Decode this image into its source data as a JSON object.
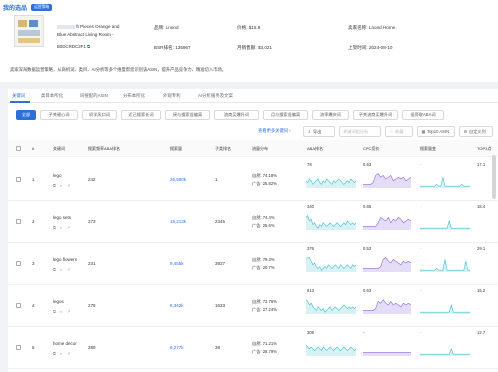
{
  "header": {
    "title": "我的选品",
    "badge": "运营策略"
  },
  "product": {
    "title_line1": "ft Pieces Orange and",
    "title_line2": "Blue Abstract Living Room -",
    "asin": "B0DCRDC2F1",
    "brand_label": "品牌:",
    "brand_value": "Lnond",
    "price_label": "价格:",
    "price_value": "$15.9",
    "seller_label": "卖家名称:",
    "seller_value": "Lnond Home",
    "bsr_label": "BSR排名:",
    "bsr_value": "135967",
    "monthly_label": "月销售额:",
    "monthly_value": "$3,021",
    "launch_label": "上架时间:",
    "launch_value": "2024-08-10"
  },
  "description": "卖家深海数据运营策略，从商机词、类目、AI分析等多个维度帮您识别该ASIN，提升产品竞争力、精准切入市场。",
  "tabs": [
    "关键词",
    "类目本所化",
    "同搜配的ASIN",
    "分布本所化",
    "外观专利",
    "AI分析服务及文案"
  ],
  "filters": [
    "全部",
    "子关键心词",
    "初学风口词",
    "近己搜索长词",
    "接与搜索竖偏离",
    "流商买爆升词",
    "月与搜索竖偏离",
    "流率爆庆词",
    "子关流商买爆升词",
    "低旁取ABA词"
  ],
  "actions": {
    "suggest": "查看更多关键词",
    "export": "导出",
    "analyze": "关键词组分析",
    "favorite": "收藏",
    "top10": "Top10 ASIN",
    "custom": "自定义列"
  },
  "columns": {
    "index": "#",
    "keyword": "关键词",
    "aba_rank": "搜索频率ABA排名",
    "search_volume": "搜索量",
    "competition": "子类排名",
    "traffic": "流量分布",
    "aba_trend": "ABA排名",
    "cpc_trend": "CPC竞价",
    "search_trend": "搜索量变",
    "top3": "TOP3点"
  },
  "rows": [
    {
      "index": "1",
      "keyword": "lego",
      "aba_rank": "242",
      "volume": "26,580k",
      "competition": "1",
      "natural": "自然: 74.18%",
      "ad": "广告: 25.82%",
      "aba_val": "78",
      "cpc_val": "0.63",
      "top3": "17.1"
    },
    {
      "index": "2",
      "keyword": "lego sets",
      "aba_rank": "273",
      "volume": "15,213k",
      "competition": "2345",
      "natural": "自然: 74.4%",
      "ad": "广告: 25.6%",
      "aba_val": "340",
      "cpc_val": "0.65",
      "top3": "18.4"
    },
    {
      "index": "3",
      "keyword": "lego flowers",
      "aba_rank": "231",
      "volume": "9,455k",
      "competition": "3927",
      "natural": "自然: 79.3%",
      "ad": "广告: 20.7%",
      "aba_val": "376",
      "cpc_val": "0.53",
      "top3": "29.1"
    },
    {
      "index": "4",
      "keyword": "legos",
      "aba_rank": "278",
      "volume": "8,342k",
      "competition": "1633",
      "natural": "自然: 72.76%",
      "ad": "广告: 27.24%",
      "aba_val": "813",
      "cpc_val": "0.63",
      "top3": "15.2"
    },
    {
      "index": "5",
      "keyword": "home decor",
      "aba_rank": "289",
      "volume": "8,277k",
      "competition": "38",
      "natural": "自然: 71.21%",
      "ad": "广告: 28.79%",
      "aba_val": "306",
      "cpc_val": "-",
      "top3": "12.7"
    }
  ],
  "colors": {
    "accent": "#2f6fdc",
    "trend_line": "#3bbfcf",
    "cpc_line": "#8c6be0"
  }
}
